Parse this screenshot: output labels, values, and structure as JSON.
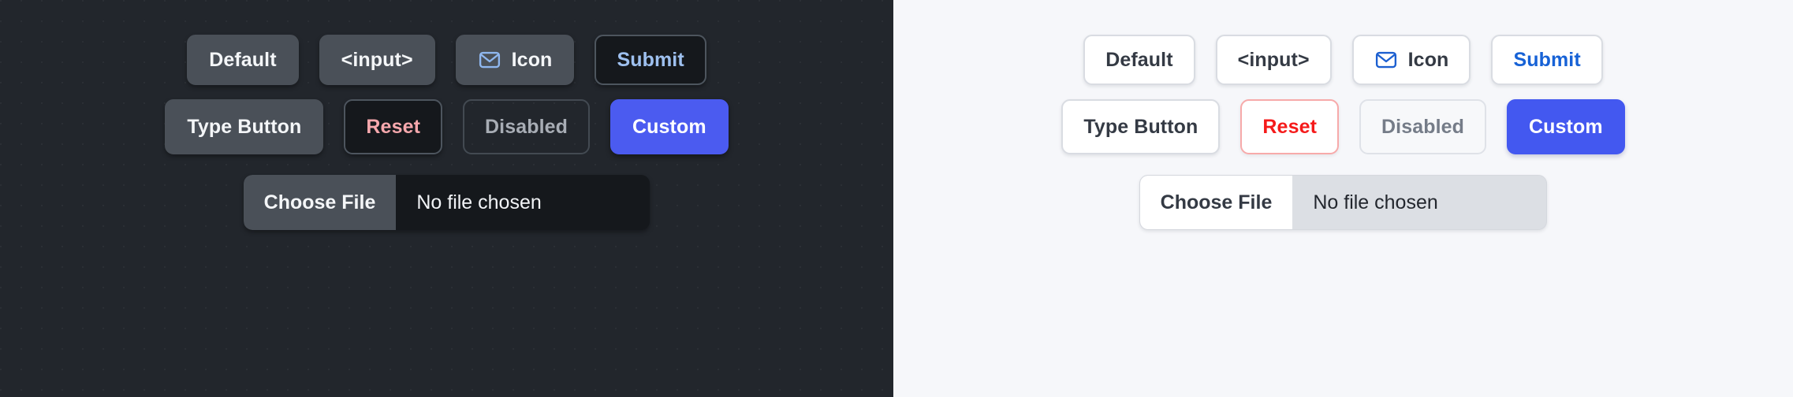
{
  "meta": {
    "title": "Button variants — dark and light theme comparison",
    "panels": [
      "dark",
      "light"
    ]
  },
  "colors": {
    "dark_background": "#22262c",
    "light_background": "#f6f7fa",
    "dark_button_fill": "#4a5058",
    "dark_button_text": "#f4f6f8",
    "dark_submit_text": "#9ec0ef",
    "dark_reset_text": "#f6a8ad",
    "dark_disabled_text": "#a8adb5",
    "dark_custom_fill": "#4b5bf0",
    "light_button_fill": "#ffffff",
    "light_button_text": "#343a44",
    "light_button_border": "#d9dce2",
    "light_submit_text": "#1762d6",
    "light_reset_text": "#f51a1a",
    "light_reset_border": "#f7aaaa",
    "light_disabled_text": "#757c88",
    "light_custom_fill": "#4358f0",
    "mail_icon_dark": "#8fb7ef",
    "mail_icon_light": "#1c5fd0",
    "file_track_dark": "#15181c",
    "file_track_light": "#dcdfe4"
  },
  "dark": {
    "row1": [
      {
        "label": "Default",
        "name": "default-button"
      },
      {
        "label": "<input>",
        "name": "input-button"
      },
      {
        "label": "Icon",
        "name": "icon-button",
        "icon": "mail-icon"
      },
      {
        "label": "Submit",
        "name": "submit-button"
      }
    ],
    "row2": [
      {
        "label": "Type Button",
        "name": "type-button"
      },
      {
        "label": "Reset",
        "name": "reset-button"
      },
      {
        "label": "Disabled",
        "name": "disabled-button"
      },
      {
        "label": "Custom",
        "name": "custom-button"
      }
    ],
    "file": {
      "button_label": "Choose File",
      "status_text": "No file chosen"
    }
  },
  "light": {
    "row1": [
      {
        "label": "Default",
        "name": "default-button"
      },
      {
        "label": "<input>",
        "name": "input-button"
      },
      {
        "label": "Icon",
        "name": "icon-button",
        "icon": "mail-icon"
      },
      {
        "label": "Submit",
        "name": "submit-button"
      }
    ],
    "row2": [
      {
        "label": "Type Button",
        "name": "type-button"
      },
      {
        "label": "Reset",
        "name": "reset-button"
      },
      {
        "label": "Disabled",
        "name": "disabled-button"
      },
      {
        "label": "Custom",
        "name": "custom-button"
      }
    ],
    "file": {
      "button_label": "Choose File",
      "status_text": "No file chosen"
    }
  }
}
